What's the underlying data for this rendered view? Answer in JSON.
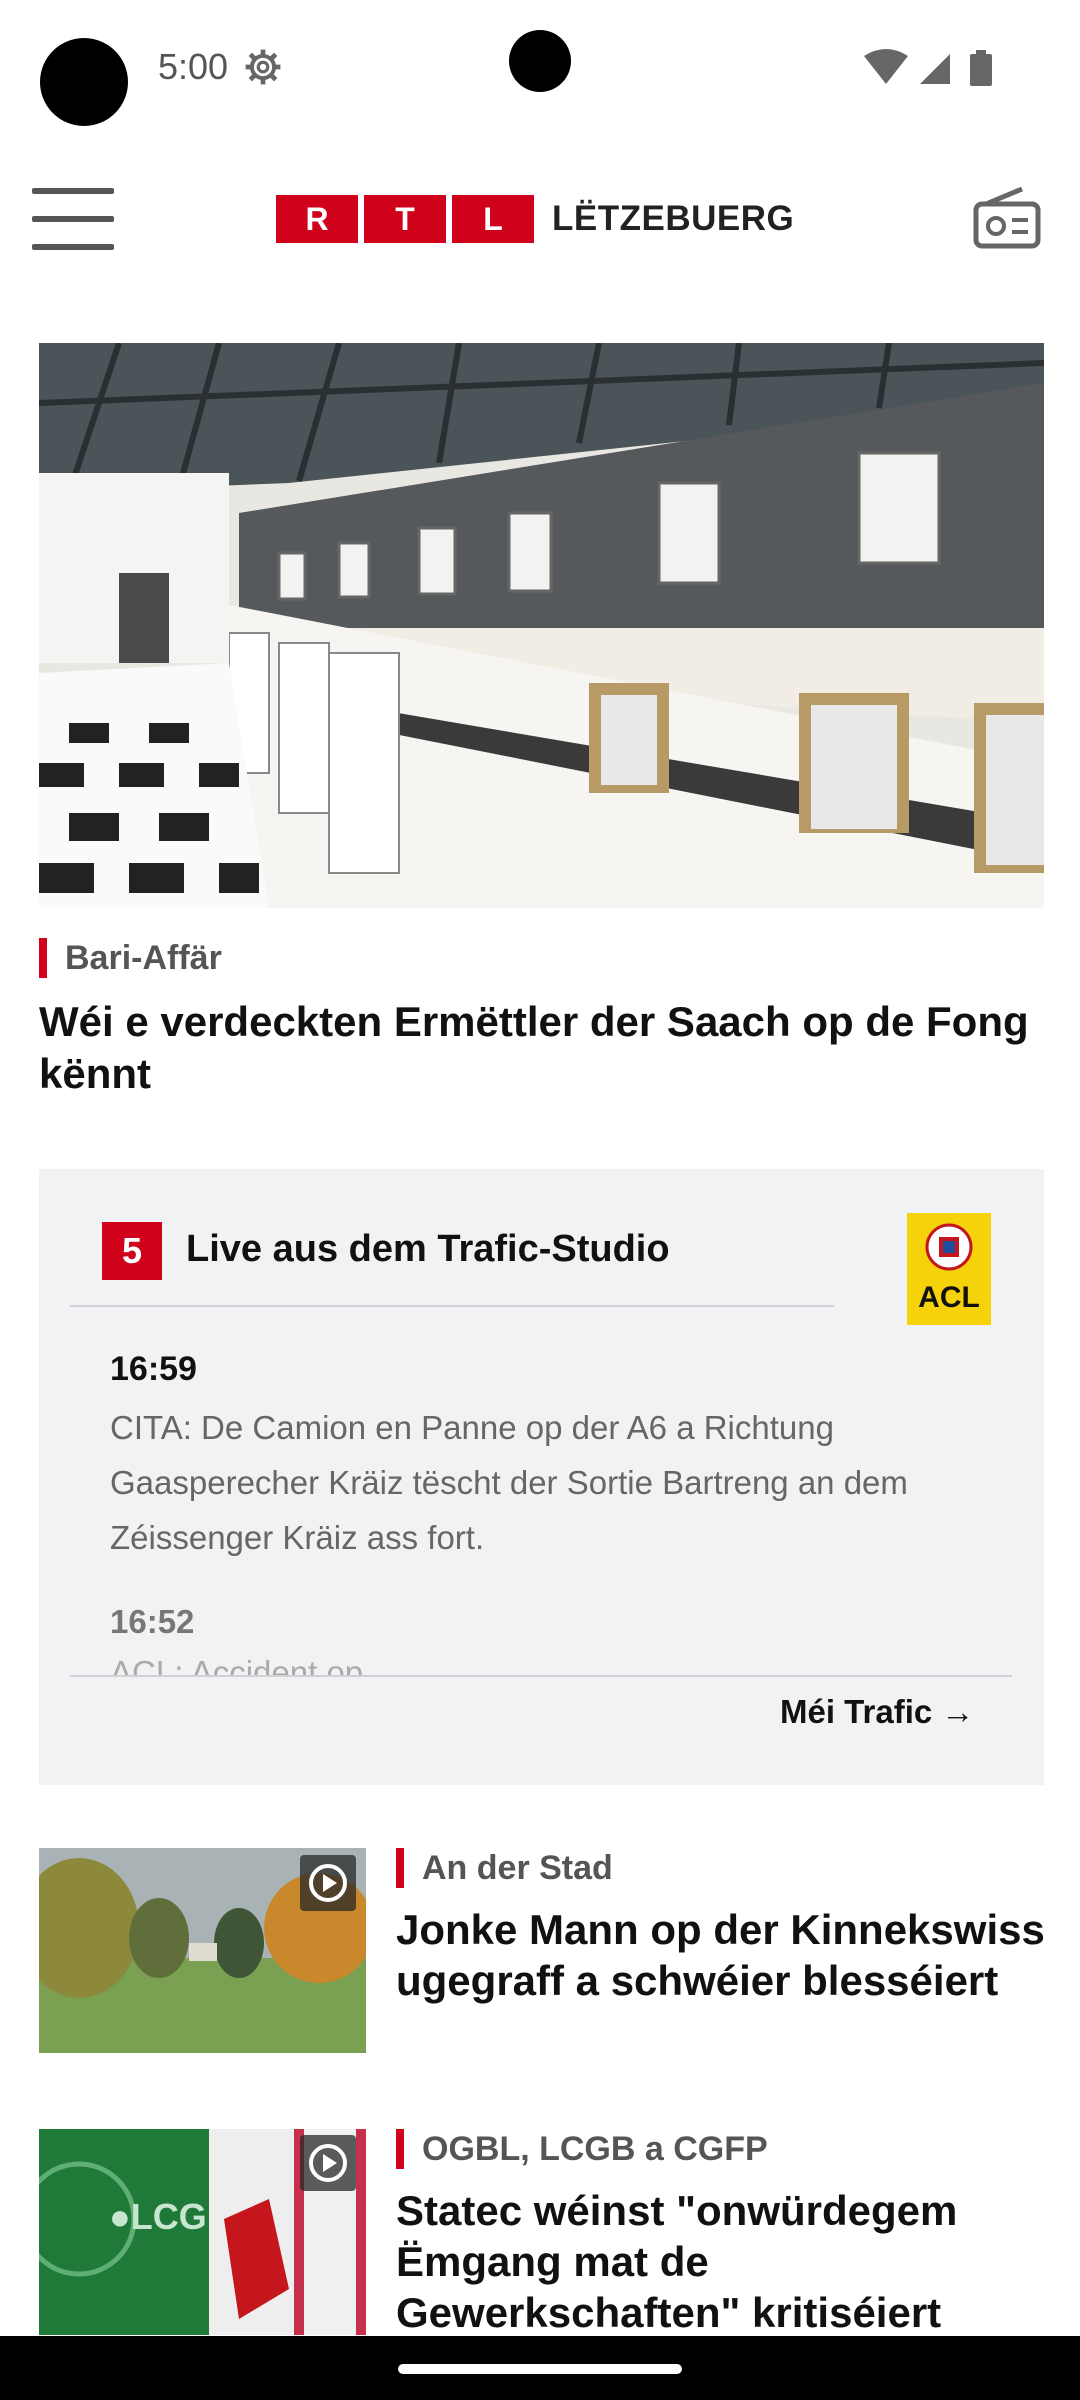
{
  "status_bar": {
    "time": "5:00"
  },
  "app_bar": {
    "logo_letters": [
      "R",
      "T",
      "L"
    ],
    "logo_word": "LËTZEBUERG",
    "brand_color": "#d0021b"
  },
  "hero": {
    "kicker": "Bari-Affär",
    "title": "Wéi e verdeckten Ermëttler der Saach op de Fong kënnt"
  },
  "traffic": {
    "badge": "5",
    "title": "Live aus dem Trafic-Studio",
    "partner_logo": "ACL",
    "entries": [
      {
        "time": "16:59",
        "text": "CITA: De Camion en Panne op der A6 a Richtung Gaasperecher Kräiz tëscht der Sortie Bartreng an dem Zéissenger Kräiz ass fort."
      },
      {
        "time": "16:52",
        "text": "ACL: Accident op ..."
      }
    ],
    "more_label": "Méi Trafic →"
  },
  "articles": [
    {
      "kicker": "An der Stad",
      "title": "Jonke Mann op der Kinnekswiss ugegraff a schwéier blesséiert"
    },
    {
      "kicker": "OGBL, LCGB a CGFP",
      "title": "Statec wéinst \"onwürdegem Ëmgang mat de Gewerkschaften\" kritiséiert"
    }
  ]
}
